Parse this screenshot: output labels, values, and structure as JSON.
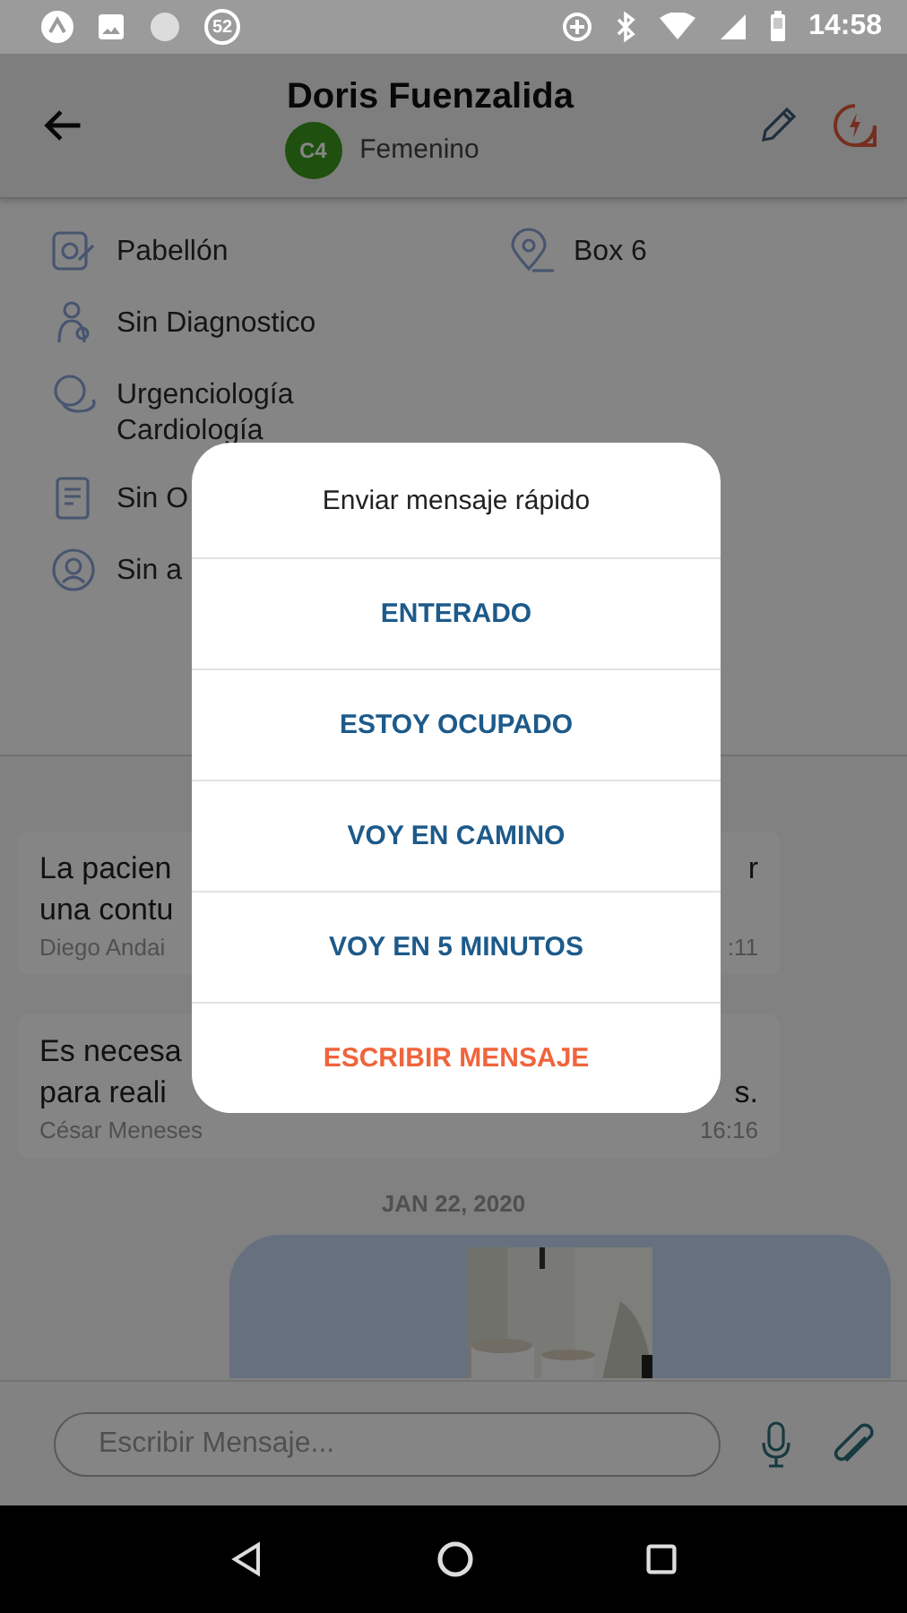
{
  "status_bar": {
    "notification_count": "52",
    "time": "14:58"
  },
  "header": {
    "title": "Doris Fuenzalida",
    "category_badge": "C4",
    "subtitle": "Femenino"
  },
  "patient_info": {
    "left_items": [
      {
        "kind": "ward",
        "lines": [
          "Pabellón"
        ]
      },
      {
        "kind": "diagnosis",
        "lines": [
          "Sin Diagnostico"
        ]
      },
      {
        "kind": "specialty",
        "lines": [
          "Urgenciología",
          "Cardiología"
        ]
      },
      {
        "kind": "document",
        "lines": [
          "Sin O"
        ]
      },
      {
        "kind": "person",
        "lines": [
          "Sin a"
        ]
      }
    ],
    "right_items": [
      {
        "kind": "location",
        "lines": [
          "Box 6"
        ]
      }
    ]
  },
  "messages": [
    {
      "kind": "text",
      "lines": [
        {
          "left": "La pacien",
          "right": "r"
        },
        {
          "left": "una contu"
        }
      ],
      "author": "Diego Andai",
      "time": ":11"
    },
    {
      "kind": "text",
      "lines": [
        {
          "left": "Es necesa"
        },
        {
          "left": "para reali",
          "right": "s."
        }
      ],
      "author": "César Meneses",
      "time": "16:16"
    },
    {
      "kind": "date",
      "text": "JAN 22, 2020"
    },
    {
      "kind": "picture"
    }
  ],
  "composer": {
    "placeholder": "Escribir Mensaje..."
  },
  "dialog": {
    "title": "Enviar mensaje rápido",
    "options": [
      {
        "label": "ENTERADO",
        "kind": "preset"
      },
      {
        "label": "ESTOY OCUPADO",
        "kind": "preset"
      },
      {
        "label": "VOY EN CAMINO",
        "kind": "preset"
      },
      {
        "label": "VOY EN 5 MINUTOS",
        "kind": "preset"
      },
      {
        "label": "ESCRIBIR MENSAJE",
        "kind": "custom"
      }
    ]
  }
}
